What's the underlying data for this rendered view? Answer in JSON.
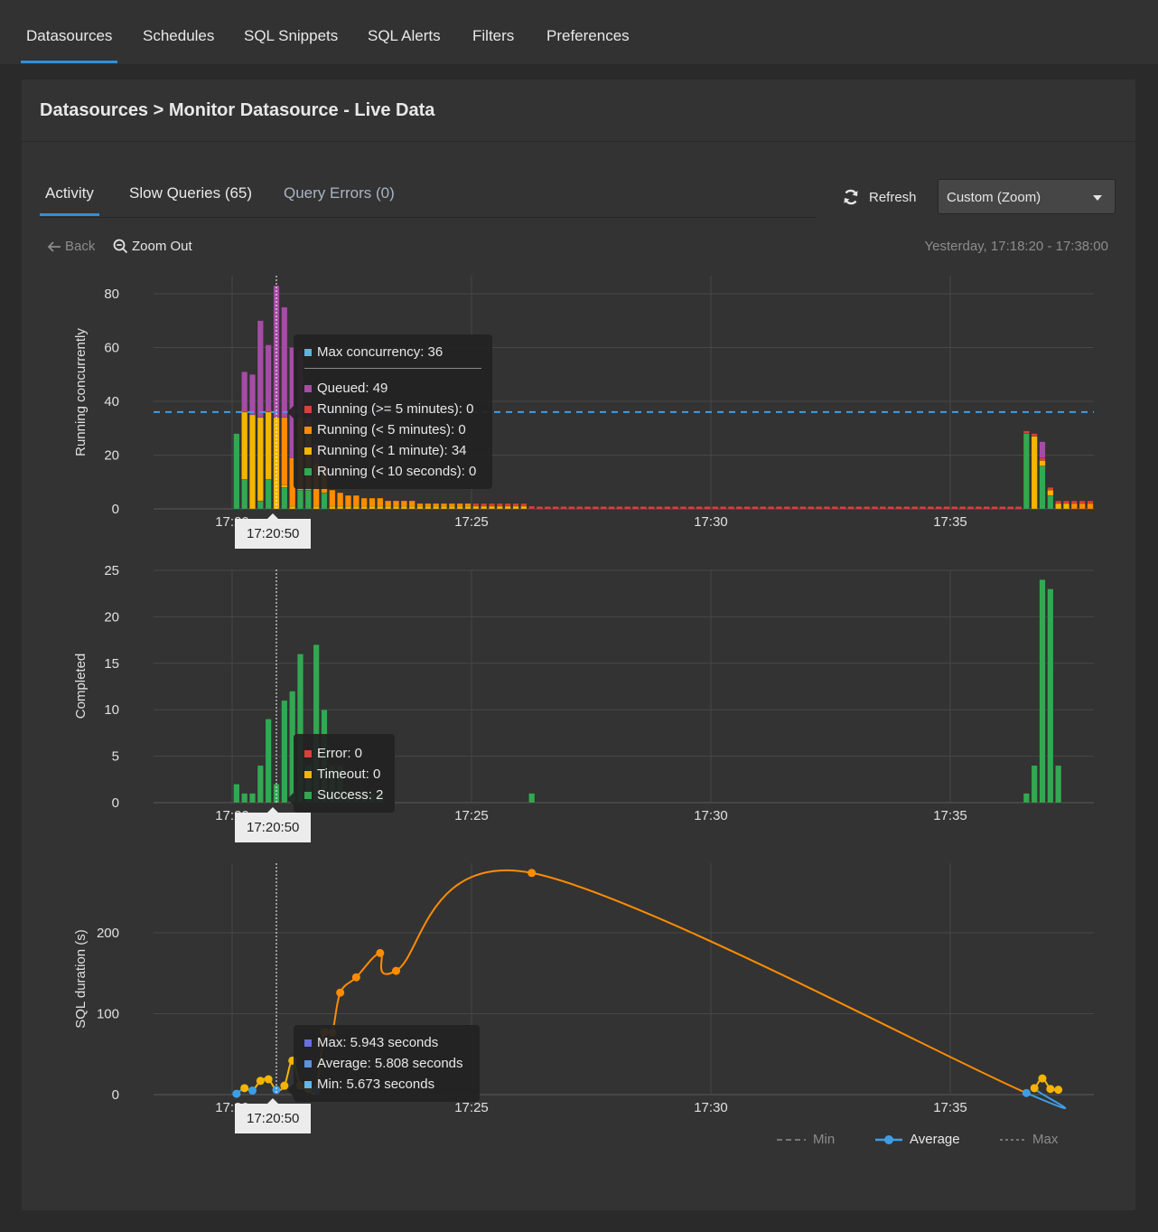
{
  "nav": {
    "tabs": [
      {
        "label": "Datasources",
        "active": true
      },
      {
        "label": "Schedules",
        "active": false
      },
      {
        "label": "SQL Snippets",
        "active": false
      },
      {
        "label": "SQL Alerts",
        "active": false
      },
      {
        "label": "Filters",
        "active": false
      },
      {
        "label": "Preferences",
        "active": false
      }
    ]
  },
  "header": {
    "breadcrumb": "Datasources > Monitor Datasource - Live Data"
  },
  "subtabs": [
    {
      "label": "Activity",
      "active": true
    },
    {
      "label": "Slow Queries (65)",
      "active": false
    },
    {
      "label": "Query Errors (0)",
      "active": false
    }
  ],
  "toolbar": {
    "refresh_label": "Refresh",
    "range_select": "Custom (Zoom)",
    "back_label": "Back",
    "zoom_out_label": "Zoom Out",
    "time_range": "Yesterday, 17:18:20 - 17:38:00"
  },
  "colors": {
    "accent": "#2f8fdb",
    "queued": "#a64ca6",
    "running_5m_plus": "#d9403a",
    "running_lt_5m": "#ff8c00",
    "running_lt_1m": "#f5b400",
    "running_lt_10s": "#33a852",
    "max_concurrency": "#3d9ee6",
    "error": "#d9403a",
    "timeout": "#f5b400",
    "success": "#33a852",
    "avg_line": "#3d9ee6"
  },
  "chart_data": [
    {
      "type": "bar",
      "stacked": true,
      "ylabel": "Running concurrently",
      "ylim": [
        0,
        85
      ],
      "yticks": [
        0,
        20,
        40,
        60,
        80
      ],
      "xlim": [
        "17:18:20",
        "17:38:00"
      ],
      "xticks": [
        "17:20",
        "17:25",
        "17:30",
        "17:35"
      ],
      "bin_seconds": 10,
      "max_concurrency": 36,
      "series_names": [
        "Running (< 10 seconds)",
        "Running (< 1 minute)",
        "Running (< 5 minutes)",
        "Running (>= 5 minutes)",
        "Queued"
      ],
      "bars": [
        {
          "t": "17:20:10",
          "v": [
            28,
            0,
            0,
            0,
            0
          ]
        },
        {
          "t": "17:20:20",
          "v": [
            11,
            25,
            0,
            0,
            15
          ]
        },
        {
          "t": "17:20:30",
          "v": [
            0,
            35,
            0,
            0,
            15
          ]
        },
        {
          "t": "17:20:40",
          "v": [
            3,
            31,
            0,
            0,
            36
          ]
        },
        {
          "t": "17:20:50",
          "v": [
            11,
            25,
            0,
            0,
            25
          ]
        },
        {
          "t": "17:21:00",
          "v": [
            0,
            34,
            0,
            0,
            49
          ]
        },
        {
          "t": "17:21:10",
          "v": [
            8,
            1,
            25,
            0,
            41
          ]
        },
        {
          "t": "17:21:20",
          "v": [
            0,
            1,
            18,
            0,
            41
          ]
        },
        {
          "t": "17:21:30",
          "v": [
            7,
            0,
            27,
            0,
            25
          ]
        },
        {
          "t": "17:21:40",
          "v": [
            7,
            0,
            24,
            0,
            3
          ]
        },
        {
          "t": "17:21:50",
          "v": [
            0,
            1,
            16,
            0,
            7
          ]
        },
        {
          "t": "17:22:00",
          "v": [
            6,
            0,
            10,
            0,
            0
          ]
        },
        {
          "t": "17:22:10",
          "v": [
            0,
            1,
            6,
            0,
            0
          ]
        },
        {
          "t": "17:22:20",
          "v": [
            0,
            1,
            5,
            0,
            0
          ]
        },
        {
          "t": "17:22:30",
          "v": [
            0,
            1,
            4,
            0,
            0
          ]
        },
        {
          "t": "17:22:40",
          "v": [
            0,
            1,
            4,
            0,
            0
          ]
        },
        {
          "t": "17:22:50",
          "v": [
            0,
            1,
            3,
            0,
            0
          ]
        },
        {
          "t": "17:23:00",
          "v": [
            0,
            1,
            3,
            0,
            0
          ]
        },
        {
          "t": "17:23:10",
          "v": [
            0,
            1,
            3,
            0,
            0
          ]
        },
        {
          "t": "17:23:20",
          "v": [
            0,
            1,
            2,
            0,
            0
          ]
        },
        {
          "t": "17:23:30",
          "v": [
            0,
            1,
            2,
            0,
            0
          ]
        },
        {
          "t": "17:23:40",
          "v": [
            0,
            1,
            2,
            0,
            0
          ]
        },
        {
          "t": "17:23:50",
          "v": [
            0,
            1,
            2,
            0,
            0
          ]
        },
        {
          "t": "17:24:00",
          "v": [
            0,
            1,
            1,
            0,
            0
          ]
        },
        {
          "t": "17:24:10",
          "v": [
            0,
            1,
            1,
            0,
            0
          ]
        },
        {
          "t": "17:24:20",
          "v": [
            0,
            1,
            1,
            0,
            0
          ]
        },
        {
          "t": "17:24:30",
          "v": [
            0,
            1,
            1,
            0,
            0
          ]
        },
        {
          "t": "17:24:40",
          "v": [
            0,
            1,
            1,
            0,
            0
          ]
        },
        {
          "t": "17:24:50",
          "v": [
            0,
            1,
            1,
            0,
            0
          ]
        },
        {
          "t": "17:25:00",
          "v": [
            0,
            1,
            1,
            0,
            0
          ]
        },
        {
          "t": "17:25:10",
          "v": [
            0,
            1,
            0,
            1,
            0
          ]
        },
        {
          "t": "17:25:20",
          "v": [
            0,
            1,
            0,
            1,
            0
          ]
        },
        {
          "t": "17:25:30",
          "v": [
            0,
            1,
            0,
            1,
            0
          ]
        },
        {
          "t": "17:25:40",
          "v": [
            0,
            1,
            0,
            1,
            0
          ]
        },
        {
          "t": "17:25:50",
          "v": [
            0,
            1,
            0,
            1,
            0
          ]
        },
        {
          "t": "17:26:00",
          "v": [
            0,
            1,
            0,
            1,
            0
          ]
        },
        {
          "t": "17:26:10",
          "v": [
            0,
            1,
            0,
            1,
            0
          ]
        },
        {
          "t": "17:26:20",
          "v": [
            0,
            0,
            0,
            1,
            0
          ]
        },
        {
          "t": "17:36:40",
          "v": [
            28,
            0,
            0,
            1,
            0
          ]
        },
        {
          "t": "17:36:50",
          "v": [
            0,
            27,
            0,
            1,
            0
          ]
        },
        {
          "t": "17:37:00",
          "v": [
            16,
            2,
            0,
            1,
            6
          ]
        },
        {
          "t": "17:37:10",
          "v": [
            5,
            2,
            0,
            1,
            0
          ]
        },
        {
          "t": "17:37:20",
          "v": [
            0,
            2,
            0,
            1,
            0
          ]
        },
        {
          "t": "17:37:30",
          "v": [
            0,
            2,
            0,
            1,
            0
          ]
        },
        {
          "t": "17:37:40",
          "v": [
            0,
            0,
            2,
            1,
            0
          ]
        },
        {
          "t": "17:37:50",
          "v": [
            0,
            0,
            2,
            1,
            0
          ]
        },
        {
          "t": "17:38:00",
          "v": [
            0,
            0,
            2,
            1,
            0
          ]
        }
      ],
      "tail_5m_plus_level": 0.5,
      "tooltip": {
        "time": "17:20:50",
        "header": "Max concurrency: 36",
        "rows": [
          "Queued: 49",
          "Running (>= 5 minutes): 0",
          "Running (< 5 minutes): 0",
          "Running (< 1 minute): 34",
          "Running (< 10 seconds): 0"
        ]
      }
    },
    {
      "type": "bar",
      "stacked": true,
      "ylabel": "Completed",
      "ylim": [
        0,
        25
      ],
      "yticks": [
        0,
        5,
        10,
        15,
        20,
        25
      ],
      "xticks": [
        "17:20",
        "17:25",
        "17:30",
        "17:35"
      ],
      "series_names": [
        "Success",
        "Timeout",
        "Error"
      ],
      "bars": [
        {
          "t": "17:20:10",
          "success": 2
        },
        {
          "t": "17:20:20",
          "success": 1
        },
        {
          "t": "17:20:30",
          "success": 1
        },
        {
          "t": "17:20:40",
          "success": 4
        },
        {
          "t": "17:20:50",
          "success": 9
        },
        {
          "t": "17:21:00",
          "success": 2
        },
        {
          "t": "17:21:10",
          "success": 11
        },
        {
          "t": "17:21:20",
          "success": 12
        },
        {
          "t": "17:21:30",
          "success": 16
        },
        {
          "t": "17:21:40",
          "success": 4
        },
        {
          "t": "17:21:50",
          "success": 17
        },
        {
          "t": "17:22:00",
          "success": 10
        },
        {
          "t": "17:22:10",
          "success": 4
        },
        {
          "t": "17:22:20",
          "success": 4
        },
        {
          "t": "17:22:30",
          "success": 1
        },
        {
          "t": "17:22:40",
          "success": 1
        },
        {
          "t": "17:22:50",
          "success": 1
        },
        {
          "t": "17:23:00",
          "success": 1
        },
        {
          "t": "17:23:10",
          "success": 1
        },
        {
          "t": "17:26:20",
          "success": 1
        },
        {
          "t": "17:36:40",
          "success": 1
        },
        {
          "t": "17:36:50",
          "success": 4
        },
        {
          "t": "17:37:00",
          "success": 24
        },
        {
          "t": "17:37:10",
          "success": 23
        },
        {
          "t": "17:37:20",
          "success": 4
        }
      ],
      "tooltip": {
        "time": "17:20:50",
        "rows": [
          "Error: 0",
          "Timeout: 0",
          "Success: 2"
        ]
      }
    },
    {
      "type": "line",
      "ylabel": "SQL duration (s)",
      "ylim": [
        0,
        280
      ],
      "yticks": [
        0,
        100,
        200
      ],
      "xticks": [
        "17:20",
        "17:25",
        "17:30",
        "17:35"
      ],
      "legend": [
        "Min",
        "Average",
        "Max"
      ],
      "legend_position": "bottom-right",
      "points": [
        {
          "t": "17:20:10",
          "avg": 1
        },
        {
          "t": "17:20:20",
          "avg": 8
        },
        {
          "t": "17:20:30",
          "avg": 5
        },
        {
          "t": "17:20:40",
          "avg": 17
        },
        {
          "t": "17:20:50",
          "avg": 19
        },
        {
          "t": "17:21:00",
          "avg": 5.8
        },
        {
          "t": "17:21:10",
          "avg": 11
        },
        {
          "t": "17:21:20",
          "avg": 42
        },
        {
          "t": "17:21:30",
          "avg": 11
        },
        {
          "t": "17:21:40",
          "avg": 7
        },
        {
          "t": "17:21:50",
          "avg": 5
        },
        {
          "t": "17:22:00",
          "avg": 77
        },
        {
          "t": "17:22:10",
          "avg": 77
        },
        {
          "t": "17:22:20",
          "avg": 126
        },
        {
          "t": "17:22:40",
          "avg": 145
        },
        {
          "t": "17:23:10",
          "avg": 175
        },
        {
          "t": "17:23:30",
          "avg": 153
        },
        {
          "t": "17:26:20",
          "avg": 274
        },
        {
          "t": "17:36:40",
          "avg": 2
        },
        {
          "t": "17:36:50",
          "avg": 8
        },
        {
          "t": "17:37:00",
          "avg": 20
        },
        {
          "t": "17:37:10",
          "avg": 7
        },
        {
          "t": "17:37:20",
          "avg": 6
        }
      ],
      "tooltip": {
        "time": "17:20:50",
        "rows": [
          "Max: 5.943 seconds",
          "Average: 5.808 seconds",
          "Min: 5.673 seconds"
        ]
      }
    }
  ]
}
